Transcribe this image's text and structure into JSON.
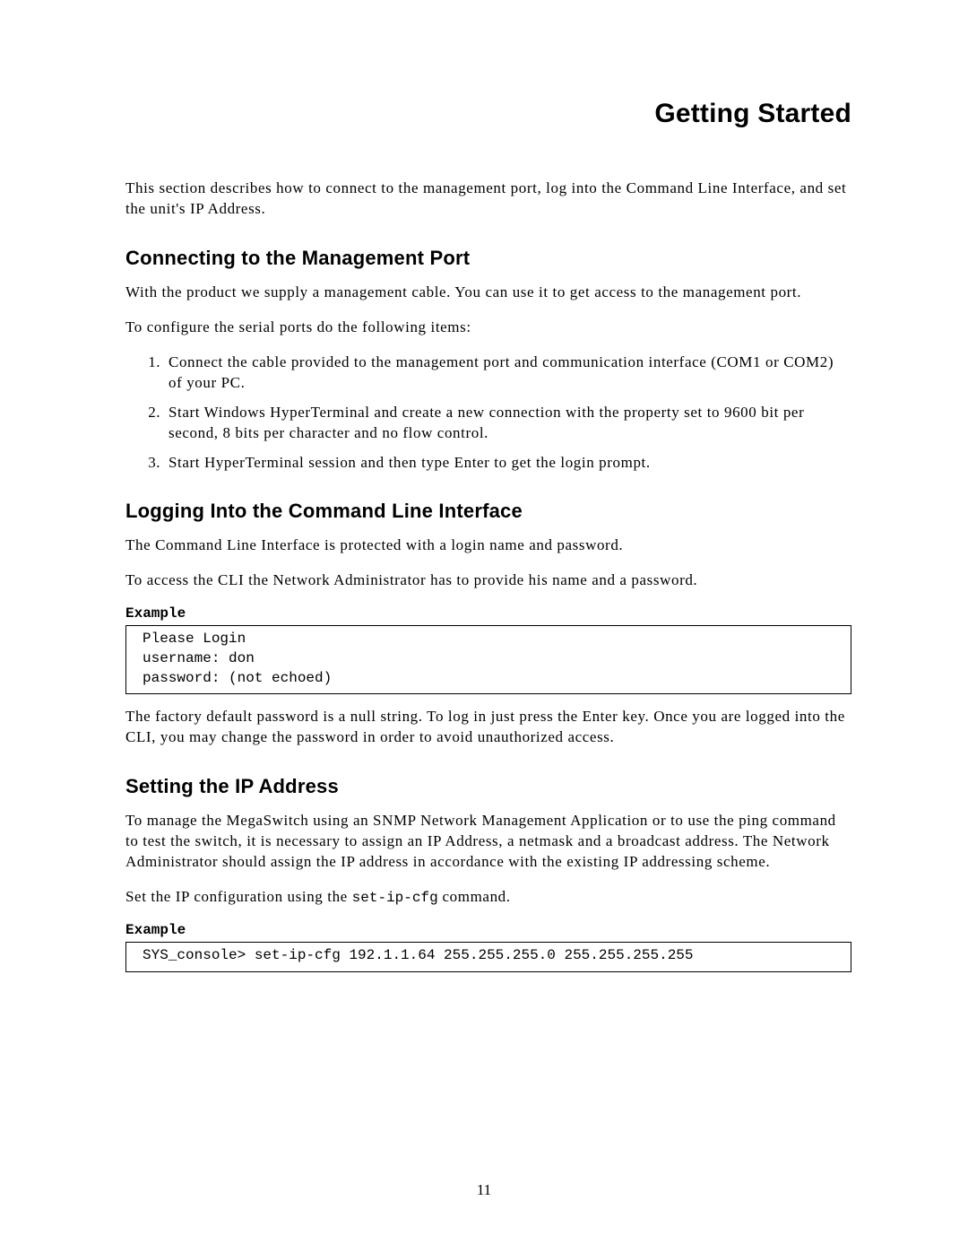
{
  "chapterTitle": "Getting Started",
  "intro": "This section describes how to connect to the management port, log into the Command Line Interface, and set the unit's IP Address.",
  "sec1": {
    "heading": "Connecting to the Management Port",
    "p1": "With the product we supply a management cable.  You can use it to get access to the management port.",
    "p2": "To configure the serial ports do the following items:",
    "steps": [
      "Connect the cable provided to the management port and communication interface (COM1 or COM2) of your PC.",
      "Start Windows HyperTerminal and create a new connection with the property set to 9600 bit per second, 8 bits per character and no flow control.",
      "Start HyperTerminal session and then type Enter to get the login prompt."
    ]
  },
  "sec2": {
    "heading": "Logging Into the Command Line Interface",
    "p1": "The Command Line Interface is protected with a login name and password.",
    "p2": "To access the CLI the Network Administrator has to provide his name and a password.",
    "exampleLabel": "Example",
    "exampleCode": "Please Login\nusername: don\npassword: (not echoed)",
    "p3": "The factory default password is a null string.  To log in just press the Enter key.  Once you are logged into the CLI, you may change the password in order to avoid unauthorized access."
  },
  "sec3": {
    "heading": "Setting the IP Address",
    "p1": "To manage the MegaSwitch using an SNMP Network Management Application or to use the ping command to test the switch, it is necessary to assign an IP Address, a netmask and a broadcast address.  The Network Administrator should assign the IP address in accordance with the existing IP addressing scheme.",
    "p2_prefix": "Set the IP configuration using the ",
    "p2_code": "set-ip-cfg",
    "p2_suffix": " command.",
    "exampleLabel": "Example",
    "exampleCode": "SYS_console> set-ip-cfg 192.1.1.64 255.255.255.0 255.255.255.255"
  },
  "pageNumber": "11"
}
